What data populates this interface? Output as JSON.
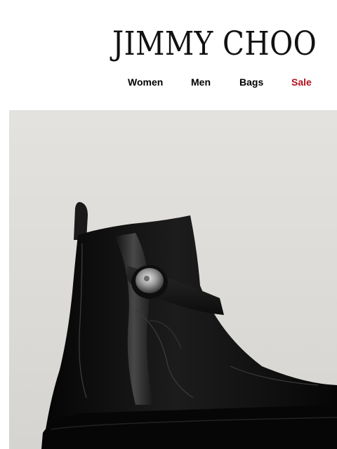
{
  "brand": {
    "name": "JIMMY CHOO"
  },
  "nav": {
    "items": [
      {
        "label": "Women"
      },
      {
        "label": "Men"
      },
      {
        "label": "Bags"
      },
      {
        "label": "Sale"
      }
    ],
    "sale_color": "#b0101c"
  },
  "hero": {
    "image": "black-leather-ankle-boot-with-button-strap",
    "background_color": "#dedcd8"
  }
}
